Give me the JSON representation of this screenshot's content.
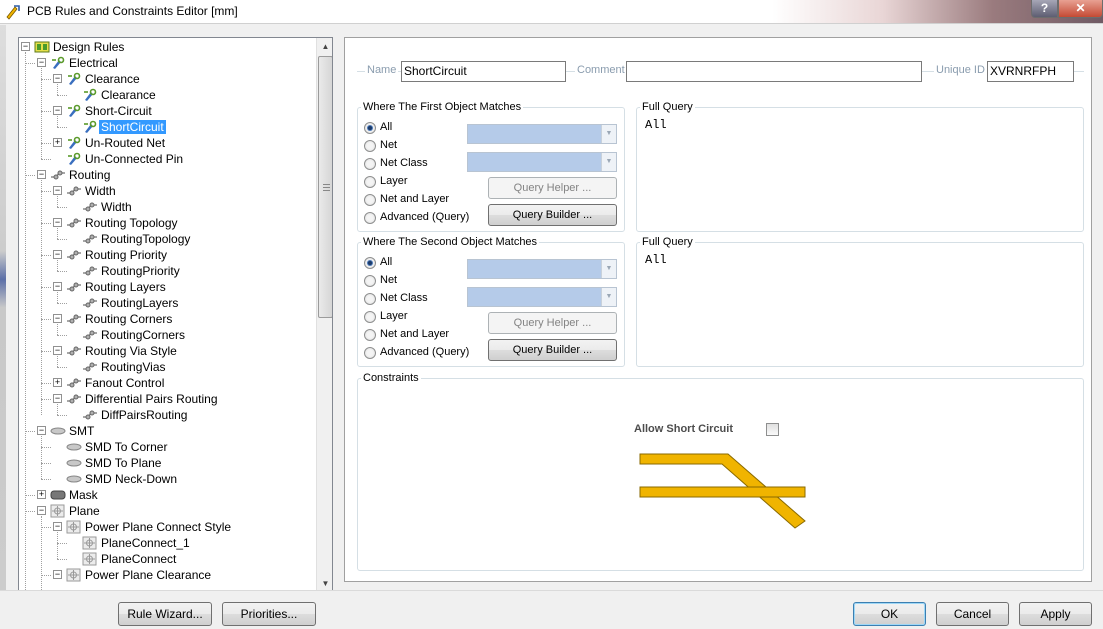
{
  "window": {
    "title": "PCB Rules and Constraints Editor [mm]",
    "help_label": "?",
    "close_label": "✕"
  },
  "tree": {
    "expander_minus": "−",
    "expander_plus": "+",
    "items": [
      {
        "label": "Design Rules",
        "level": 0,
        "expander": "minus",
        "icon": "design-rules"
      },
      {
        "label": "Electrical",
        "level": 1,
        "expander": "minus",
        "icon": "electrical"
      },
      {
        "label": "Clearance",
        "level": 2,
        "expander": "minus",
        "icon": "electrical"
      },
      {
        "label": "Clearance",
        "level": 3,
        "expander": "",
        "icon": "electrical"
      },
      {
        "label": "Short-Circuit",
        "level": 2,
        "expander": "minus",
        "icon": "electrical"
      },
      {
        "label": "ShortCircuit",
        "level": 3,
        "expander": "",
        "icon": "electrical",
        "selected": true
      },
      {
        "label": "Un-Routed Net",
        "level": 2,
        "expander": "plus",
        "icon": "electrical"
      },
      {
        "label": "Un-Connected Pin",
        "level": 2,
        "expander": "",
        "icon": "electrical"
      },
      {
        "label": "Routing",
        "level": 1,
        "expander": "minus",
        "icon": "routing"
      },
      {
        "label": "Width",
        "level": 2,
        "expander": "minus",
        "icon": "routing"
      },
      {
        "label": "Width",
        "level": 3,
        "expander": "",
        "icon": "routing"
      },
      {
        "label": "Routing Topology",
        "level": 2,
        "expander": "minus",
        "icon": "routing"
      },
      {
        "label": "RoutingTopology",
        "level": 3,
        "expander": "",
        "icon": "routing"
      },
      {
        "label": "Routing Priority",
        "level": 2,
        "expander": "minus",
        "icon": "routing"
      },
      {
        "label": "RoutingPriority",
        "level": 3,
        "expander": "",
        "icon": "routing"
      },
      {
        "label": "Routing Layers",
        "level": 2,
        "expander": "minus",
        "icon": "routing"
      },
      {
        "label": "RoutingLayers",
        "level": 3,
        "expander": "",
        "icon": "routing"
      },
      {
        "label": "Routing Corners",
        "level": 2,
        "expander": "minus",
        "icon": "routing"
      },
      {
        "label": "RoutingCorners",
        "level": 3,
        "expander": "",
        "icon": "routing"
      },
      {
        "label": "Routing Via Style",
        "level": 2,
        "expander": "minus",
        "icon": "routing"
      },
      {
        "label": "RoutingVias",
        "level": 3,
        "expander": "",
        "icon": "routing"
      },
      {
        "label": "Fanout Control",
        "level": 2,
        "expander": "plus",
        "icon": "routing"
      },
      {
        "label": "Differential Pairs Routing",
        "level": 2,
        "expander": "minus",
        "icon": "routing"
      },
      {
        "label": "DiffPairsRouting",
        "level": 3,
        "expander": "",
        "icon": "routing"
      },
      {
        "label": "SMT",
        "level": 1,
        "expander": "minus",
        "icon": "smt"
      },
      {
        "label": "SMD To Corner",
        "level": 2,
        "expander": "",
        "icon": "smt"
      },
      {
        "label": "SMD To Plane",
        "level": 2,
        "expander": "",
        "icon": "smt"
      },
      {
        "label": "SMD Neck-Down",
        "level": 2,
        "expander": "",
        "icon": "smt"
      },
      {
        "label": "Mask",
        "level": 1,
        "expander": "plus",
        "icon": "mask"
      },
      {
        "label": "Plane",
        "level": 1,
        "expander": "minus",
        "icon": "plane"
      },
      {
        "label": "Power Plane Connect Style",
        "level": 2,
        "expander": "minus",
        "icon": "plane"
      },
      {
        "label": "PlaneConnect_1",
        "level": 3,
        "expander": "",
        "icon": "plane"
      },
      {
        "label": "PlaneConnect",
        "level": 3,
        "expander": "",
        "icon": "plane"
      },
      {
        "label": "Power Plane Clearance",
        "level": 2,
        "expander": "minus",
        "icon": "plane"
      }
    ],
    "scroll_up": "▲",
    "scroll_down": "▼"
  },
  "rule": {
    "name_label": "Name",
    "name_value": "ShortCircuit",
    "comment_label": "Comment",
    "comment_value": "",
    "uid_label": "Unique ID",
    "uid_value": "XVRNRFPH"
  },
  "first_match": {
    "title": "Where The First Object Matches",
    "options": [
      "All",
      "Net",
      "Net Class",
      "Layer",
      "Net and Layer",
      "Advanced (Query)"
    ],
    "selected": "All",
    "query_helper_label": "Query Helper ...",
    "query_builder_label": "Query Builder ...",
    "full_query_title": "Full Query",
    "full_query_text": "All"
  },
  "second_match": {
    "title": "Where The Second Object Matches",
    "options": [
      "All",
      "Net",
      "Net Class",
      "Layer",
      "Net and Layer",
      "Advanced (Query)"
    ],
    "selected": "All",
    "query_helper_label": "Query Helper ...",
    "query_builder_label": "Query Builder ...",
    "full_query_title": "Full Query",
    "full_query_text": "All"
  },
  "constraints": {
    "title": "Constraints",
    "allow_short_label": "Allow Short Circuit",
    "allow_short_checked": false,
    "track_color": "#f0b400"
  },
  "footer": {
    "rule_wizard_label": "Rule Wizard...",
    "priorities_label": "Priorities...",
    "ok_label": "OK",
    "cancel_label": "Cancel",
    "apply_label": "Apply"
  }
}
